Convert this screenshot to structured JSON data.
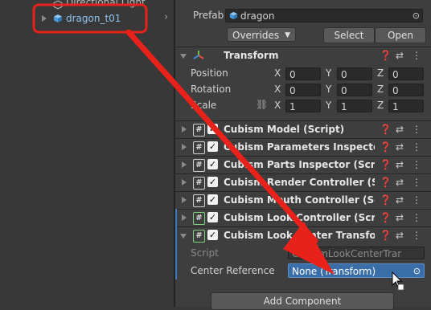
{
  "hierarchy": {
    "items": [
      {
        "label": "Directional Light"
      },
      {
        "label": "dragon_t01"
      }
    ]
  },
  "inspector": {
    "prefab_label": "Prefab",
    "prefab_value": "dragon",
    "overrides_label": "Overrides",
    "select_label": "Select",
    "open_label": "Open",
    "transform": {
      "title": "Transform",
      "position_label": "Position",
      "rotation_label": "Rotation",
      "scale_label": "Scale",
      "axis_x": "X",
      "axis_y": "Y",
      "axis_z": "Z",
      "position": [
        "0",
        "0",
        "0"
      ],
      "rotation": [
        "0",
        "0",
        "0"
      ],
      "scale": [
        "1",
        "1",
        "1"
      ]
    },
    "components": [
      {
        "title": "Cubism Model (Script)"
      },
      {
        "title": "Cubism Parameters Inspector (Sc"
      },
      {
        "title": "Cubism Parts Inspector (Script)"
      },
      {
        "title": "Cubism Render Controller (Script"
      },
      {
        "title": "Cubism Mouth Controller (Script)"
      },
      {
        "title": "Cubism Look Controller (Script)"
      },
      {
        "title": "Cubism Look Center Transform ("
      }
    ],
    "script_label": "Script",
    "script_value": "CubismLookCenterTrar",
    "center_reference_label": "Center Reference",
    "center_reference_value": "None (Transform)",
    "add_component_label": "Add Component"
  },
  "colors": {
    "arrow": "#e8221b",
    "highlight_box": "#e8221b",
    "selected_field": "#3a6ea8",
    "accent_bar": "#3a79bb"
  }
}
